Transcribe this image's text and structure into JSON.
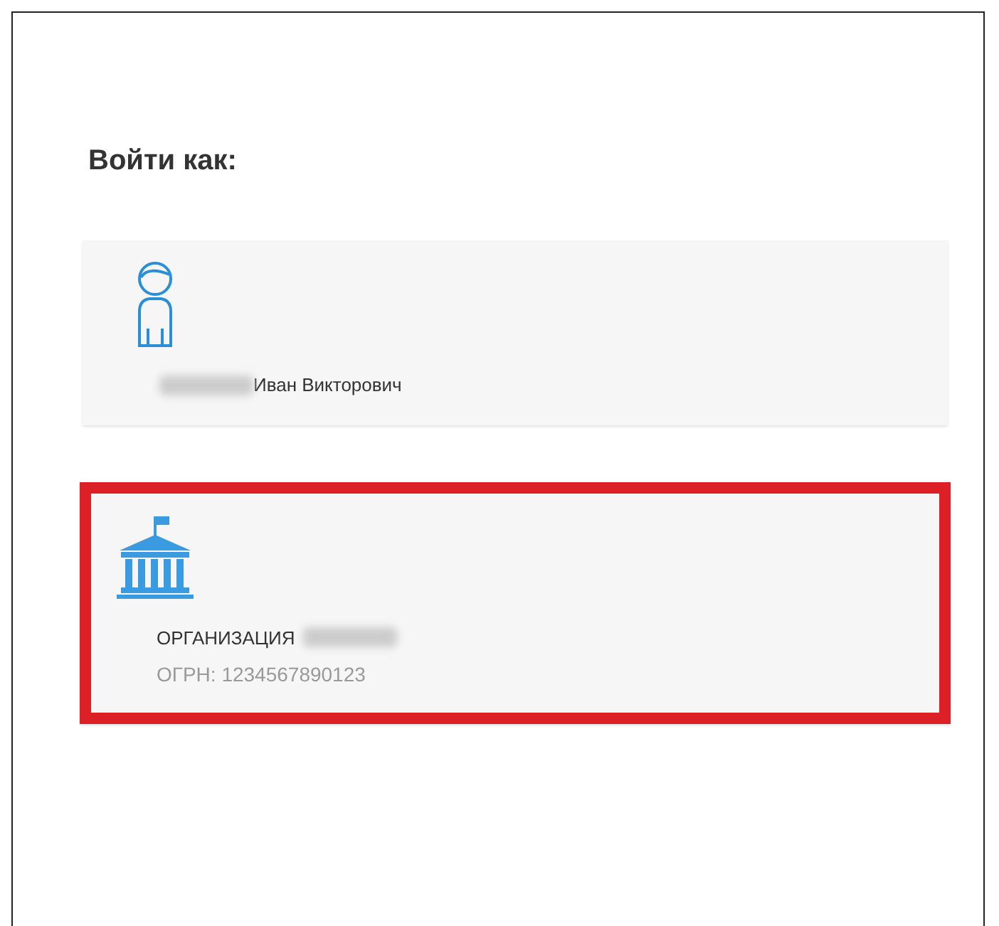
{
  "heading": "Войти как:",
  "options": [
    {
      "kind": "person",
      "name": "Иван Викторович",
      "name_redacted": true,
      "highlighted": false
    },
    {
      "kind": "organization",
      "name": "ОРГАНИЗАЦИЯ",
      "name_redacted": true,
      "detail": "ОГРН: 1234567890123",
      "highlighted": true
    }
  ]
}
